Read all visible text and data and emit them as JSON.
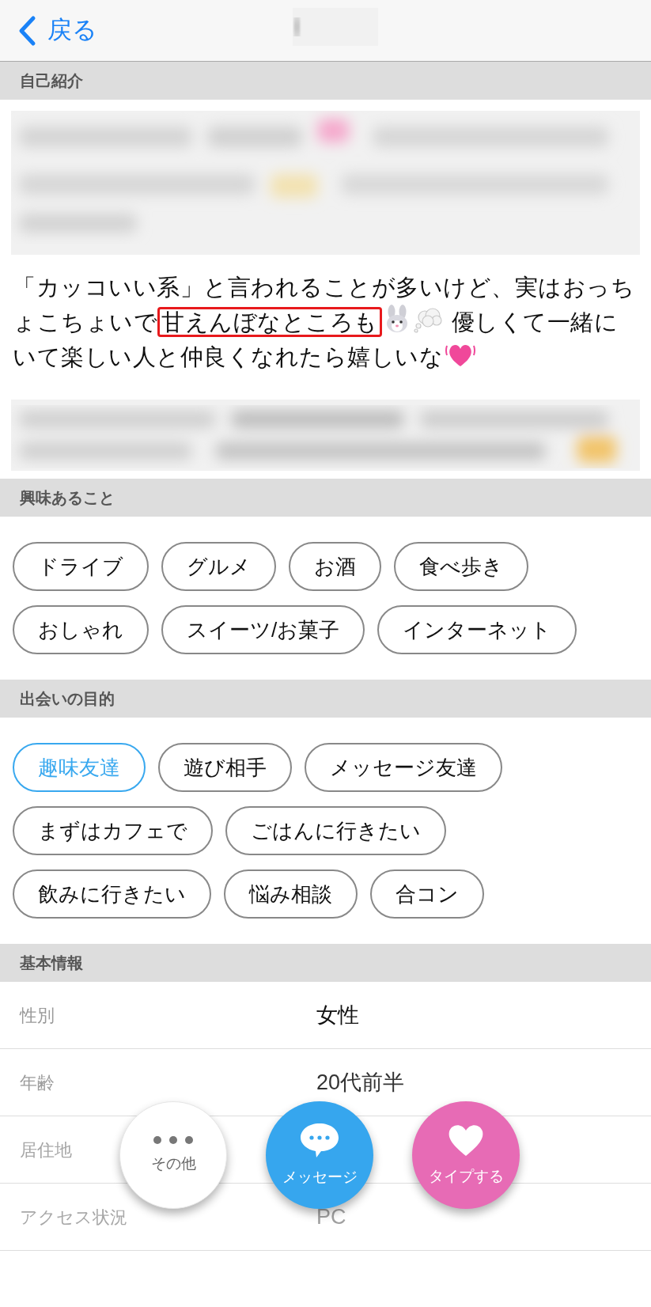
{
  "nav": {
    "back_label": "戻る"
  },
  "intro": {
    "header": "自己紹介",
    "segments": [
      {
        "kind": "text",
        "text": "「カッコいい系」と言われることが多いけど、実はおっちょこちょいで"
      },
      {
        "kind": "highlight",
        "text": "甘えんぼなところも"
      },
      {
        "kind": "rabbit"
      },
      {
        "kind": "thought"
      },
      {
        "kind": "text",
        "text": " 優しくて一緒にいて楽しい人と仲良くなれたら嬉しいな"
      },
      {
        "kind": "heart"
      }
    ]
  },
  "interests": {
    "header": "興味あること",
    "tags": [
      "ドライブ",
      "グルメ",
      "お酒",
      "食べ歩き",
      "おしゃれ",
      "スイーツ/お菓子",
      "インターネット"
    ]
  },
  "purposes": {
    "header": "出会いの目的",
    "tags": [
      {
        "label": "趣味友達",
        "selected": true
      },
      {
        "label": "遊び相手",
        "selected": false
      },
      {
        "label": "メッセージ友達",
        "selected": false
      },
      {
        "label": "まずはカフェで",
        "selected": false
      },
      {
        "label": "ごはんに行きたい",
        "selected": false
      },
      {
        "label": "飲みに行きたい",
        "selected": false
      },
      {
        "label": "悩み相談",
        "selected": false
      },
      {
        "label": "合コン",
        "selected": false
      }
    ]
  },
  "basic_info": {
    "header": "基本情報",
    "rows": [
      {
        "label": "性別",
        "value": "女性"
      },
      {
        "label": "年齢",
        "value": "20代前半"
      },
      {
        "label": "居住地"
      },
      {
        "label": "アクセス状況",
        "value": "PC"
      }
    ]
  },
  "actions": [
    {
      "kind": "more",
      "label": "その他"
    },
    {
      "kind": "message",
      "label": "メッセージ"
    },
    {
      "kind": "like",
      "label": "タイプする"
    }
  ]
}
